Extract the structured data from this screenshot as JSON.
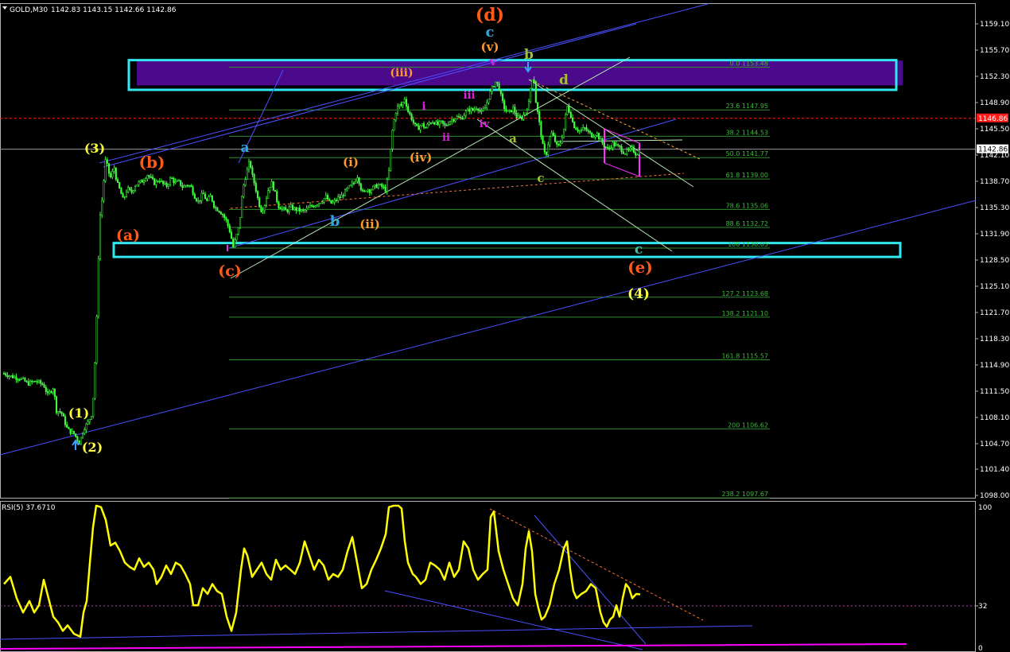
{
  "header": {
    "symbol": "GOLD,M30",
    "ohlc": "1142.83 1143.15 1142.66 1142.86"
  },
  "price_axis": {
    "ticks": [
      "1159.10",
      "1155.70",
      "1152.30",
      "1148.90",
      "1145.50",
      "1142.10",
      "1138.70",
      "1135.30",
      "1131.90",
      "1128.50",
      "1125.10",
      "1121.70",
      "1118.30",
      "1114.90",
      "1111.50",
      "1108.10",
      "1104.70",
      "1101.40",
      "1098.00"
    ],
    "bid_label": "1146.86",
    "last_label": "1142.86"
  },
  "rsi": {
    "title": "RSI(5) 37.6710",
    "axis_top": "100",
    "axis_level": "32",
    "axis_bottom": "0"
  },
  "fib_levels": [
    {
      "label": "0.0 1153.48",
      "price": 1153.48
    },
    {
      "label": "23.6 1147.95",
      "price": 1147.95
    },
    {
      "label": "38.2 1144.53",
      "price": 1144.53
    },
    {
      "label": "50.0 1141.77",
      "price": 1141.77
    },
    {
      "label": "61.8 1139.00",
      "price": 1139.0
    },
    {
      "label": "78.6 1135.06",
      "price": 1135.06
    },
    {
      "label": "88.6 1132.72",
      "price": 1132.72
    },
    {
      "label": "100 1130.05",
      "price": 1130.05
    },
    {
      "label": "127.2 1123.68",
      "price": 1123.68
    },
    {
      "label": "138.2 1121.10",
      "price": 1121.1
    },
    {
      "label": "161.8 1115.57",
      "price": 1115.57
    },
    {
      "label": "200 1106.62",
      "price": 1106.62
    },
    {
      "label": "238.2 1097.67",
      "price": 1097.67
    }
  ],
  "wave_labels": [
    {
      "text": "(d)",
      "color": "#ff5a1a"
    },
    {
      "text": "c",
      "color": "#2ea8e0"
    },
    {
      "text": "(v)",
      "color": "#ff9a30"
    },
    {
      "text": "v",
      "color": "#e020e0"
    },
    {
      "text": "b",
      "color": "#a0c030"
    },
    {
      "text": "d",
      "color": "#a0c030"
    },
    {
      "text": "(iii)",
      "color": "#ff9a30"
    },
    {
      "text": "i",
      "color": "#e020e0"
    },
    {
      "text": "iii",
      "color": "#e020e0"
    },
    {
      "text": "iv",
      "color": "#e020e0"
    },
    {
      "text": "ii",
      "color": "#e020e0"
    },
    {
      "text": "a",
      "color": "#a0c030"
    },
    {
      "text": "c",
      "color": "#a0c030"
    },
    {
      "text": "(3)",
      "color": "#ffff40"
    },
    {
      "text": "(b)",
      "color": "#ff5a1a"
    },
    {
      "text": "a",
      "color": "#2ea8e0"
    },
    {
      "text": "(i)",
      "color": "#ff9a30"
    },
    {
      "text": "(iv)",
      "color": "#ff9a30"
    },
    {
      "text": "b",
      "color": "#2ea8e0"
    },
    {
      "text": "(ii)",
      "color": "#ff9a30"
    },
    {
      "text": "(a)",
      "color": "#ff5a1a"
    },
    {
      "text": "(c)",
      "color": "#ff5a1a"
    },
    {
      "text": "c",
      "color": "#40c0a0"
    },
    {
      "text": "(e)",
      "color": "#ff5a1a"
    },
    {
      "text": "(4)",
      "color": "#ffff40"
    },
    {
      "text": "(1)",
      "color": "#ffff40"
    },
    {
      "text": "(2)",
      "color": "#ffff40"
    }
  ],
  "colors": {
    "background": "#000000",
    "candles": "#40ff40",
    "zones": "#30e8f0",
    "zone_fill": "#4b0a8c",
    "trendlines": "#4a50ff",
    "rsi_line": "#ffff00",
    "rsi_floor": "#ff00ff"
  },
  "chart_data": {
    "type": "candlestick",
    "symbol": "GOLD",
    "timeframe": "M30",
    "ylim": [
      1096.5,
      1160.5
    ],
    "close_path": [
      [
        0,
        1113.8
      ],
      [
        10,
        1113.4
      ],
      [
        20,
        1113.2
      ],
      [
        30,
        1112.5
      ],
      [
        40,
        1112.8
      ],
      [
        50,
        1112.3
      ],
      [
        55,
        1111.0
      ],
      [
        62,
        1112.0
      ],
      [
        66,
        1109.0
      ],
      [
        72,
        1108.8
      ],
      [
        80,
        1106.5
      ],
      [
        88,
        1106.0
      ],
      [
        95,
        1104.8
      ],
      [
        100,
        1106.6
      ],
      [
        106,
        1107.5
      ],
      [
        110,
        1108.5
      ],
      [
        113,
        1111.5
      ],
      [
        117,
        1122.0
      ],
      [
        120,
        1133.5
      ],
      [
        123,
        1136.0
      ],
      [
        126,
        1139.5
      ],
      [
        128,
        1141.8
      ],
      [
        131,
        1140.0
      ],
      [
        135,
        1139.0
      ],
      [
        138,
        1140.8
      ],
      [
        142,
        1138.5
      ],
      [
        146,
        1137.5
      ],
      [
        150,
        1136.2
      ],
      [
        155,
        1137.8
      ],
      [
        160,
        1137.2
      ],
      [
        165,
        1138.2
      ],
      [
        170,
        1138.5
      ],
      [
        175,
        1138.8
      ],
      [
        180,
        1139.6
      ],
      [
        185,
        1139.0
      ],
      [
        190,
        1138.4
      ],
      [
        195,
        1139.0
      ],
      [
        200,
        1138.3
      ],
      [
        205,
        1138.1
      ],
      [
        210,
        1139.2
      ],
      [
        215,
        1138.5
      ],
      [
        220,
        1138.6
      ],
      [
        225,
        1137.9
      ],
      [
        230,
        1138.3
      ],
      [
        235,
        1138.0
      ],
      [
        240,
        1136.7
      ],
      [
        245,
        1136.0
      ],
      [
        250,
        1137.2
      ],
      [
        255,
        1136.1
      ],
      [
        260,
        1136.8
      ],
      [
        265,
        1135.3
      ],
      [
        270,
        1135.0
      ],
      [
        275,
        1134.4
      ],
      [
        280,
        1133.5
      ],
      [
        285,
        1131.9
      ],
      [
        288,
        1130.1
      ],
      [
        292,
        1131.5
      ],
      [
        296,
        1133.0
      ],
      [
        300,
        1137.5
      ],
      [
        303,
        1139.0
      ],
      [
        306,
        1140.2
      ],
      [
        309,
        1141.4
      ],
      [
        312,
        1139.5
      ],
      [
        316,
        1138.0
      ],
      [
        320,
        1136.0
      ],
      [
        324,
        1134.8
      ],
      [
        328,
        1135.8
      ],
      [
        332,
        1137.5
      ],
      [
        336,
        1138.6
      ],
      [
        340,
        1137.5
      ],
      [
        345,
        1135.5
      ],
      [
        350,
        1135.2
      ],
      [
        355,
        1134.8
      ],
      [
        360,
        1135.4
      ],
      [
        365,
        1135.1
      ],
      [
        370,
        1135.0
      ],
      [
        375,
        1134.8
      ],
      [
        380,
        1135.0
      ],
      [
        385,
        1135.4
      ],
      [
        390,
        1135.6
      ],
      [
        395,
        1135.9
      ],
      [
        400,
        1136.2
      ],
      [
        405,
        1136.7
      ],
      [
        410,
        1135.8
      ],
      [
        415,
        1136.0
      ],
      [
        420,
        1136.5
      ],
      [
        425,
        1136.8
      ],
      [
        430,
        1137.5
      ],
      [
        435,
        1138.0
      ],
      [
        440,
        1138.5
      ],
      [
        445,
        1139.5
      ],
      [
        448,
        1138.0
      ],
      [
        452,
        1137.0
      ],
      [
        456,
        1137.8
      ],
      [
        460,
        1137.5
      ],
      [
        465,
        1137.9
      ],
      [
        470,
        1138.2
      ],
      [
        475,
        1138.0
      ],
      [
        480,
        1137.6
      ],
      [
        484,
        1140.0
      ],
      [
        488,
        1145.0
      ],
      [
        492,
        1147.5
      ],
      [
        496,
        1148.6
      ],
      [
        500,
        1148.5
      ],
      [
        504,
        1149.5
      ],
      [
        508,
        1147.8
      ],
      [
        512,
        1147.0
      ],
      [
        516,
        1146.0
      ],
      [
        520,
        1145.5
      ],
      [
        525,
        1146.1
      ],
      [
        530,
        1145.6
      ],
      [
        535,
        1146.3
      ],
      [
        540,
        1146.5
      ],
      [
        545,
        1146.0
      ],
      [
        550,
        1146.3
      ],
      [
        555,
        1145.8
      ],
      [
        560,
        1146.5
      ],
      [
        565,
        1146.8
      ],
      [
        570,
        1147.0
      ],
      [
        575,
        1146.8
      ],
      [
        580,
        1147.6
      ],
      [
        585,
        1148.0
      ],
      [
        590,
        1147.9
      ],
      [
        595,
        1148.4
      ],
      [
        600,
        1147.5
      ],
      [
        605,
        1148.2
      ],
      [
        610,
        1149.8
      ],
      [
        615,
        1151.0
      ],
      [
        618,
        1151.6
      ],
      [
        622,
        1151.0
      ],
      [
        626,
        1149.2
      ],
      [
        630,
        1148.0
      ],
      [
        635,
        1147.5
      ],
      [
        640,
        1148.2
      ],
      [
        645,
        1147.0
      ],
      [
        650,
        1146.8
      ],
      [
        655,
        1147.5
      ],
      [
        660,
        1148.8
      ],
      [
        663,
        1151.5
      ],
      [
        666,
        1152.8
      ],
      [
        668,
        1149.5
      ],
      [
        672,
        1147.0
      ],
      [
        675,
        1145.0
      ],
      [
        678,
        1143.0
      ],
      [
        681,
        1141.8
      ],
      [
        684,
        1143.5
      ],
      [
        688,
        1145.0
      ],
      [
        692,
        1144.2
      ],
      [
        696,
        1143.0
      ],
      [
        700,
        1143.8
      ],
      [
        704,
        1145.5
      ],
      [
        708,
        1148.5
      ],
      [
        712,
        1147.5
      ],
      [
        716,
        1146.0
      ],
      [
        720,
        1145.5
      ],
      [
        725,
        1145.2
      ],
      [
        730,
        1145.6
      ],
      [
        735,
        1145.0
      ],
      [
        740,
        1144.6
      ],
      [
        745,
        1145.0
      ],
      [
        750,
        1144.0
      ],
      [
        755,
        1143.3
      ],
      [
        760,
        1142.8
      ],
      [
        765,
        1143.6
      ],
      [
        770,
        1143.3
      ],
      [
        775,
        1143.0
      ],
      [
        780,
        1142.4
      ],
      [
        785,
        1142.6
      ],
      [
        790,
        1142.9
      ],
      [
        795,
        1142.2
      ],
      [
        800,
        1142.86
      ]
    ],
    "price_ticks": [
      1159.1,
      1155.7,
      1152.3,
      1148.9,
      1145.5,
      1142.1,
      1138.7,
      1135.3,
      1131.9,
      1128.5,
      1125.1,
      1121.7,
      1118.3,
      1114.9,
      1111.5,
      1108.1,
      1104.7,
      1101.4,
      1098.0
    ],
    "horizontal_levels": {
      "bid": 1146.86,
      "last": 1142.86
    },
    "resistance_zone": [
      1150.55,
      1154.4
    ],
    "support_zone": [
      1128.9,
      1130.7
    ],
    "rsi": {
      "period": 5,
      "last": 37.671,
      "level": 32,
      "ylim": [
        0,
        100
      ],
      "values": [
        [
          0,
          45
        ],
        [
          8,
          50
        ],
        [
          16,
          35
        ],
        [
          24,
          25
        ],
        [
          32,
          33
        ],
        [
          38,
          25
        ],
        [
          44,
          30
        ],
        [
          50,
          48
        ],
        [
          56,
          35
        ],
        [
          62,
          22
        ],
        [
          68,
          18
        ],
        [
          74,
          12
        ],
        [
          80,
          16
        ],
        [
          88,
          10
        ],
        [
          96,
          8
        ],
        [
          100,
          25
        ],
        [
          104,
          33
        ],
        [
          108,
          60
        ],
        [
          112,
          85
        ],
        [
          116,
          100
        ],
        [
          122,
          99
        ],
        [
          128,
          90
        ],
        [
          134,
          72
        ],
        [
          140,
          74
        ],
        [
          146,
          68
        ],
        [
          152,
          60
        ],
        [
          158,
          57
        ],
        [
          164,
          55
        ],
        [
          170,
          63
        ],
        [
          176,
          57
        ],
        [
          182,
          60
        ],
        [
          188,
          55
        ],
        [
          192,
          45
        ],
        [
          198,
          50
        ],
        [
          204,
          58
        ],
        [
          210,
          52
        ],
        [
          216,
          60
        ],
        [
          222,
          58
        ],
        [
          228,
          52
        ],
        [
          234,
          45
        ],
        [
          238,
          30
        ],
        [
          244,
          30
        ],
        [
          250,
          42
        ],
        [
          256,
          38
        ],
        [
          262,
          45
        ],
        [
          268,
          40
        ],
        [
          274,
          38
        ],
        [
          280,
          22
        ],
        [
          286,
          12
        ],
        [
          292,
          25
        ],
        [
          298,
          55
        ],
        [
          302,
          70
        ],
        [
          306,
          65
        ],
        [
          312,
          50
        ],
        [
          318,
          55
        ],
        [
          324,
          60
        ],
        [
          330,
          52
        ],
        [
          336,
          48
        ],
        [
          342,
          62
        ],
        [
          348,
          55
        ],
        [
          354,
          58
        ],
        [
          360,
          55
        ],
        [
          366,
          52
        ],
        [
          372,
          60
        ],
        [
          378,
          75
        ],
        [
          384,
          65
        ],
        [
          390,
          55
        ],
        [
          396,
          62
        ],
        [
          402,
          58
        ],
        [
          408,
          48
        ],
        [
          414,
          52
        ],
        [
          420,
          50
        ],
        [
          426,
          55
        ],
        [
          432,
          68
        ],
        [
          438,
          78
        ],
        [
          444,
          60
        ],
        [
          450,
          42
        ],
        [
          456,
          45
        ],
        [
          462,
          55
        ],
        [
          468,
          62
        ],
        [
          474,
          70
        ],
        [
          480,
          80
        ],
        [
          484,
          99
        ],
        [
          490,
          100
        ],
        [
          496,
          100
        ],
        [
          500,
          98
        ],
        [
          504,
          75
        ],
        [
          508,
          60
        ],
        [
          514,
          52
        ],
        [
          518,
          50
        ],
        [
          524,
          45
        ],
        [
          530,
          48
        ],
        [
          536,
          60
        ],
        [
          542,
          58
        ],
        [
          548,
          55
        ],
        [
          554,
          48
        ],
        [
          560,
          60
        ],
        [
          566,
          50
        ],
        [
          572,
          55
        ],
        [
          578,
          75
        ],
        [
          584,
          70
        ],
        [
          590,
          55
        ],
        [
          596,
          48
        ],
        [
          602,
          52
        ],
        [
          608,
          55
        ],
        [
          612,
          92
        ],
        [
          616,
          96
        ],
        [
          622,
          68
        ],
        [
          628,
          55
        ],
        [
          634,
          45
        ],
        [
          640,
          35
        ],
        [
          646,
          30
        ],
        [
          652,
          45
        ],
        [
          656,
          70
        ],
        [
          660,
          82
        ],
        [
          664,
          68
        ],
        [
          668,
          38
        ],
        [
          672,
          28
        ],
        [
          676,
          20
        ],
        [
          680,
          22
        ],
        [
          686,
          30
        ],
        [
          692,
          45
        ],
        [
          698,
          55
        ],
        [
          704,
          70
        ],
        [
          708,
          75
        ],
        [
          712,
          55
        ],
        [
          716,
          40
        ],
        [
          720,
          35
        ],
        [
          726,
          38
        ],
        [
          732,
          40
        ],
        [
          738,
          45
        ],
        [
          744,
          42
        ],
        [
          750,
          25
        ],
        [
          754,
          18
        ],
        [
          758,
          15
        ],
        [
          762,
          20
        ],
        [
          766,
          22
        ],
        [
          770,
          30
        ],
        [
          774,
          22
        ],
        [
          778,
          35
        ],
        [
          782,
          45
        ],
        [
          786,
          42
        ],
        [
          790,
          35
        ],
        [
          795,
          38
        ],
        [
          800,
          37.7
        ]
      ]
    }
  }
}
